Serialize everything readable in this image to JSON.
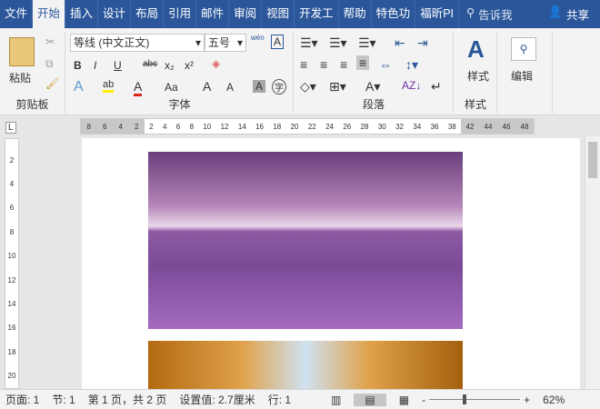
{
  "tabs": [
    "文件",
    "开始",
    "插入",
    "设计",
    "布局",
    "引用",
    "邮件",
    "审阅",
    "视图",
    "开发工",
    "帮助",
    "特色功",
    "福昕PI"
  ],
  "tell_me": "告诉我",
  "share": "共享",
  "ribbon": {
    "clipboard": {
      "label": "剪贴板",
      "paste": "粘贴"
    },
    "font": {
      "label": "字体",
      "font_name": "等线 (中文正文)",
      "font_size": "五号",
      "bold": "B",
      "italic": "I",
      "underline": "U",
      "strike": "abc",
      "sub": "x₂",
      "sup": "x²",
      "grow": "A",
      "shrink": "A",
      "case": "Aa",
      "phonetic": "wén",
      "char_border": "A",
      "char_shade": "A",
      "enclose": "字",
      "highlight_color": "#ffee00",
      "font_color": "#d9251c"
    },
    "paragraph": {
      "label": "段落"
    },
    "styles": {
      "label": "样式",
      "button": "样式"
    },
    "editing": {
      "button": "编辑"
    }
  },
  "ruler": {
    "h_left": [
      "8",
      "6",
      "4",
      "2"
    ],
    "h_marks": [
      "2",
      "4",
      "6",
      "8",
      "10",
      "12",
      "14",
      "16",
      "18",
      "20",
      "22",
      "24",
      "26",
      "28",
      "30",
      "32",
      "34",
      "36",
      "38"
    ],
    "h_right": [
      "42",
      "44",
      "46",
      "48"
    ],
    "v_marks": [
      "2",
      "4",
      "6",
      "8",
      "10",
      "12",
      "14",
      "16",
      "18",
      "20"
    ]
  },
  "status": {
    "page": "页面: 1",
    "section": "节: 1",
    "page_of": "第 1 页，共 2 页",
    "setting": "设置值: 2.7厘米",
    "line": "行: 1",
    "zoom": "62%",
    "zoom_level": 62
  }
}
